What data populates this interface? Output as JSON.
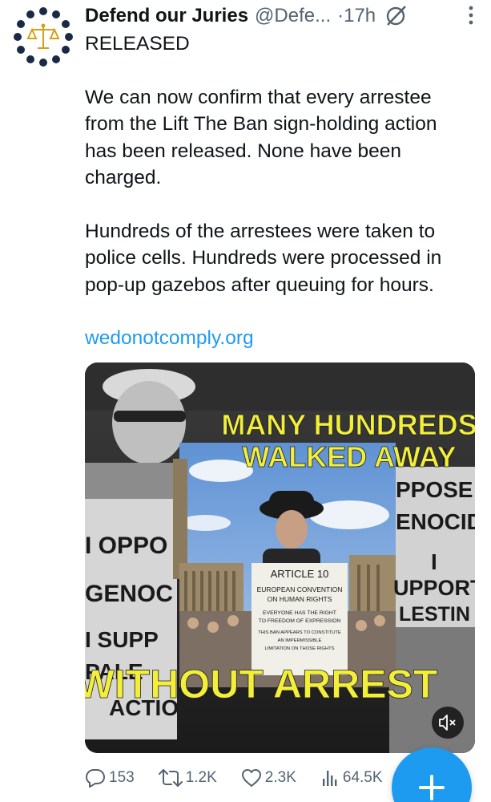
{
  "tweet": {
    "author": {
      "display_name": "Defend our Juries",
      "handle": "@Defe...",
      "separator": "·",
      "time": "17h",
      "avatar_icon": "scales-of-justice-logo"
    },
    "text": {
      "title": "RELEASED",
      "paragraph_1": "We can now confirm that every arrestee\nfrom the Lift The Ban sign-holding action\nhas been released. None have been\ncharged.",
      "paragraph_2": "Hundreds of the arrestees were taken to\npolice cells. Hundreds were processed in\npop-up gazebos after queuing for hours.",
      "link": "wedonotcomply.org"
    },
    "media": {
      "type": "video",
      "overlay_top_line1": "MANY HUNDREDS",
      "overlay_top_line2": "WALKED AWAY",
      "overlay_bottom": "WITHOUT ARREST",
      "overlay_color": "#f2ee3a",
      "sign_left": [
        "I OPPO",
        "GENOC",
        "I SUPP",
        "PALE",
        "ACTIO"
      ],
      "sign_right": [
        "I",
        "PPOSE",
        "ENOCID",
        "I",
        "UPPORT",
        "LESTIN"
      ],
      "sign_center": [
        "ARTICLE 10",
        "EUROPEAN CONVENTION",
        "ON HUMAN RIGHTS",
        "EVERYONE HAS THE RIGHT",
        "TO FREEDOM OF EXPRESSION",
        "THIS BAN APPEARS TO CONSTITUTE",
        "AN IMPERMISSIBLE",
        "LIMITATION ON THOSE RIGHTS"
      ],
      "mute_icon": "speaker-muted-icon"
    },
    "actions": {
      "replies": "153",
      "reposts": "1.2K",
      "likes": "2.3K",
      "views": "64.5K"
    },
    "compose_icon": "plus-icon"
  },
  "colors": {
    "accent": "#1d9bf0",
    "text_primary": "#0f1419",
    "text_secondary": "#536471",
    "avatar_gold": "#d4a017",
    "avatar_dark": "#1a2a44"
  }
}
